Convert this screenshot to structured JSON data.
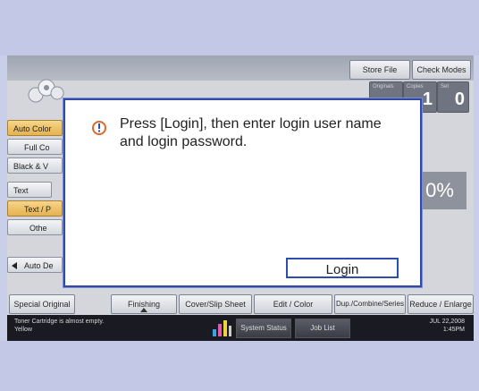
{
  "toolbar": {
    "store_file": "Store File",
    "check_modes": "Check Modes"
  },
  "counters": {
    "originals_caption": "Originals",
    "copies_caption": "Copies",
    "copies_value": "1",
    "set_caption": "Set",
    "set_value": "0"
  },
  "left_menu": {
    "auto_color": "Auto Color",
    "full_color": "Full Co",
    "black_white": "Black & V",
    "text": "Text",
    "text_photo": "Text / P",
    "other": "Othe",
    "auto_density": "Auto De"
  },
  "ratio_partial": "0%",
  "tabs": {
    "special_original": "Special Original",
    "finishing": "Finishing",
    "cover_slip": "Cover/Slip Sheet",
    "edit_color": "Edit / Color",
    "dup_combine": "Dup./Combine/Series",
    "reduce_enlarge": "Reduce / Enlarge"
  },
  "status": {
    "message_line1": "Toner Cartridge is almost empty.",
    "message_line2": "Yellow",
    "system_status": "System Status",
    "job_list": "Job List",
    "date": "JUL 22,2008",
    "time": "1:45PM"
  },
  "dialog": {
    "message": "Press [Login], then enter login user name and login password.",
    "login_button": "Login"
  },
  "colors": {
    "dialog_border": "#2f4aa8",
    "accent_orange": "#e5b24e",
    "warning_icon": "#e0672a"
  }
}
